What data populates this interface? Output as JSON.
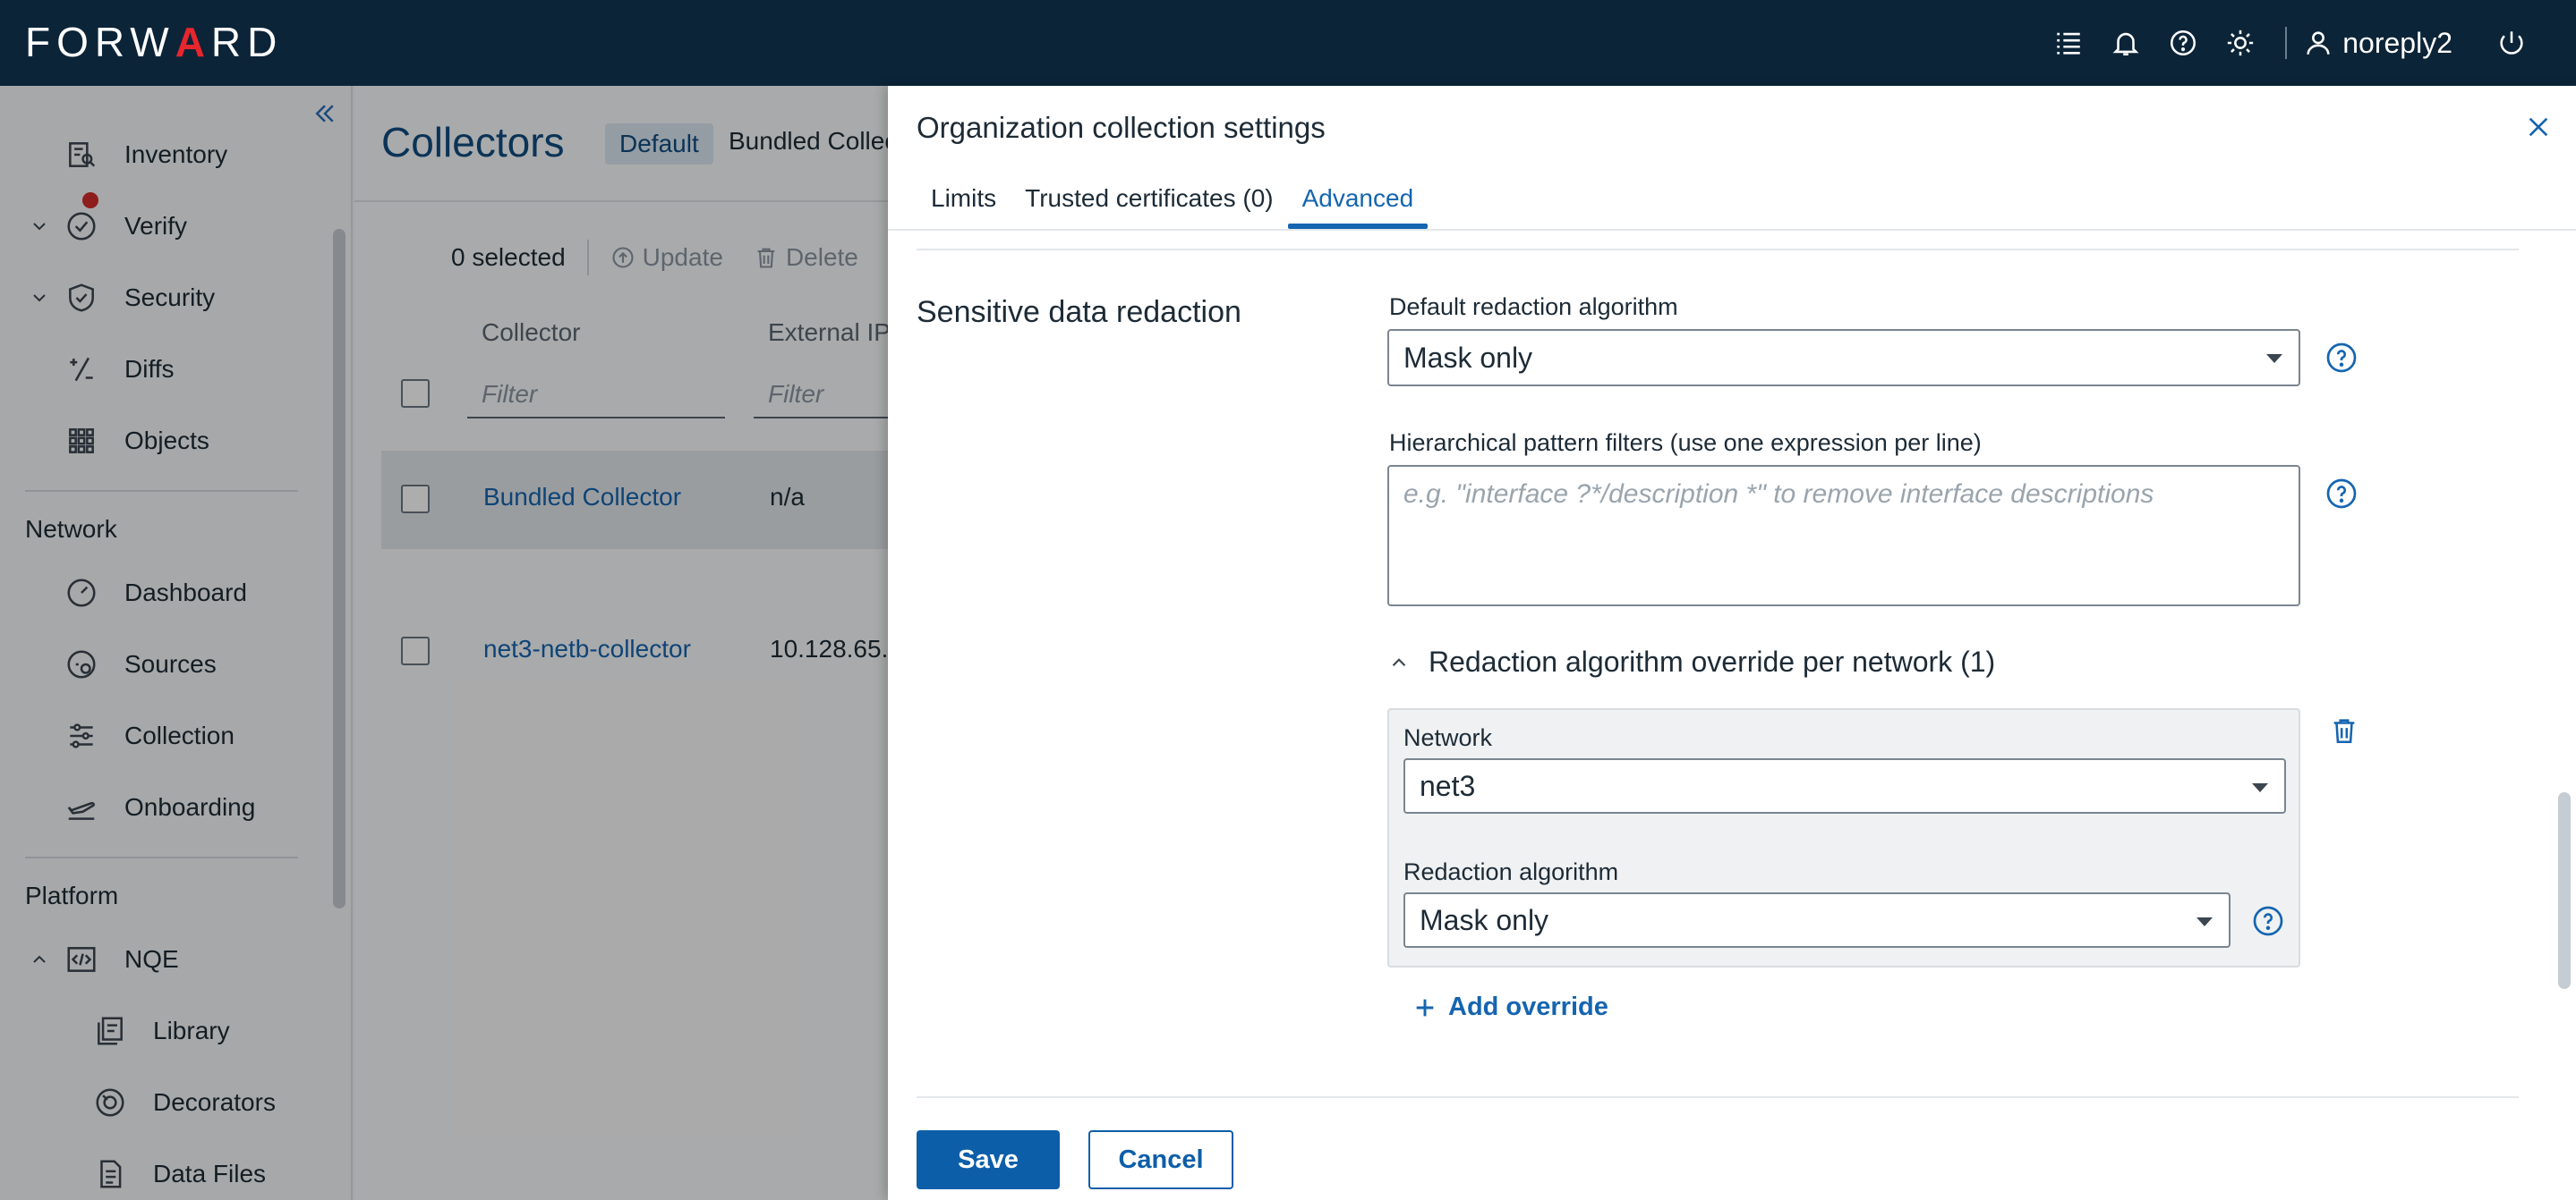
{
  "app": {
    "logo_prefix": "FORW",
    "logo_arrow": "A",
    "logo_suffix": "RD",
    "username": "noreply2"
  },
  "sidebar": {
    "items": [
      {
        "label": "Inventory"
      },
      {
        "label": "Verify"
      },
      {
        "label": "Security"
      },
      {
        "label": "Diffs"
      },
      {
        "label": "Objects"
      }
    ],
    "network_title": "Network",
    "network_items": [
      {
        "label": "Dashboard"
      },
      {
        "label": "Sources"
      },
      {
        "label": "Collection"
      },
      {
        "label": "Onboarding"
      }
    ],
    "platform_title": "Platform",
    "platform_items": [
      {
        "label": "NQE"
      },
      {
        "label": "Library"
      },
      {
        "label": "Decorators"
      },
      {
        "label": "Data Files"
      }
    ]
  },
  "main": {
    "title": "Collectors",
    "default_chip": "Default",
    "bundled_crumb": "Bundled Collec",
    "selected_count": "0 selected",
    "update_label": "Update",
    "delete_label": "Delete",
    "columns": [
      "Collector",
      "External IP"
    ],
    "filter_placeholder": "Filter",
    "rows": [
      {
        "collector": "Bundled Collector",
        "ip": "n/a"
      },
      {
        "collector": "net3-netb-collector",
        "ip": "10.128.65."
      }
    ]
  },
  "drawer": {
    "title": "Organization collection settings",
    "tabs": [
      "Limits",
      "Trusted certificates (0)",
      "Advanced"
    ],
    "active_tab": "Advanced",
    "section_title": "Sensitive data redaction",
    "default_algo_label": "Default redaction algorithm",
    "default_algo_value": "Mask only",
    "pattern_label": "Hierarchical pattern filters (use one expression per line)",
    "pattern_placeholder": "e.g. \"interface ?*/description *\" to remove interface descriptions",
    "override_header": "Redaction algorithm override per network (1)",
    "override": {
      "network_label": "Network",
      "network_value": "net3",
      "algo_label": "Redaction algorithm",
      "algo_value": "Mask only"
    },
    "add_override": "Add override",
    "save": "Save",
    "cancel": "Cancel"
  },
  "colors": {
    "topbar": "#0c2438",
    "accent": "#1565b0",
    "primary_button": "#0d5ea8",
    "logo_arrow": "#e8262d"
  }
}
